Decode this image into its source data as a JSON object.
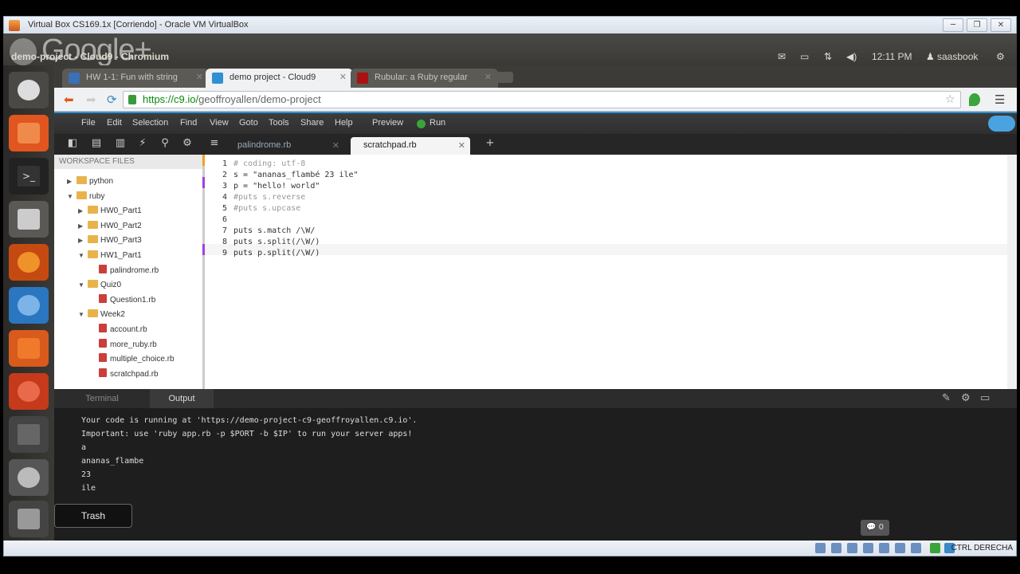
{
  "vbox": {
    "title": "Virtual Box CS169.1x [Corriendo] - Oracle VM VirtualBox",
    "status_hostkey": "CTRL DERECHA"
  },
  "ubuntu": {
    "window_title": "demo-project - Cloud9 - Chromium",
    "overlay": "Google+",
    "time": "12:11 PM",
    "user": "saasbook"
  },
  "browser": {
    "tabs": [
      {
        "label": "HW 1-1: Fun with string"
      },
      {
        "label": "demo project - Cloud9"
      },
      {
        "label": "Rubular: a Ruby regular"
      }
    ],
    "url_prefix": "https://c9.io/",
    "url_path": "geoffroyallen/demo-project"
  },
  "c9": {
    "menu": [
      "File",
      "Edit",
      "Selection",
      "Find",
      "View",
      "Goto",
      "Tools",
      "Share",
      "Help"
    ],
    "preview": "Preview",
    "run": "Run",
    "file_tabs": [
      "palindrome.rb",
      "scratchpad.rb"
    ],
    "workspace_header": "WORKSPACE FILES",
    "tree": [
      {
        "label": "python",
        "depth": 0,
        "kind": "folder",
        "arrow": "▶"
      },
      {
        "label": "ruby",
        "depth": 0,
        "kind": "folder",
        "arrow": "▼"
      },
      {
        "label": "HW0_Part1",
        "depth": 1,
        "kind": "folder",
        "arrow": "▶"
      },
      {
        "label": "HW0_Part2",
        "depth": 1,
        "kind": "folder",
        "arrow": "▶"
      },
      {
        "label": "HW0_Part3",
        "depth": 1,
        "kind": "folder",
        "arrow": "▶"
      },
      {
        "label": "HW1_Part1",
        "depth": 1,
        "kind": "folder",
        "arrow": "▼"
      },
      {
        "label": "palindrome.rb",
        "depth": 2,
        "kind": "file",
        "arrow": ""
      },
      {
        "label": "Quiz0",
        "depth": 1,
        "kind": "folder",
        "arrow": "▼"
      },
      {
        "label": "Question1.rb",
        "depth": 2,
        "kind": "file",
        "arrow": ""
      },
      {
        "label": "Week2",
        "depth": 1,
        "kind": "folder",
        "arrow": "▼"
      },
      {
        "label": "account.rb",
        "depth": 2,
        "kind": "file",
        "arrow": ""
      },
      {
        "label": "more_ruby.rb",
        "depth": 2,
        "kind": "file",
        "arrow": ""
      },
      {
        "label": "multiple_choice.rb",
        "depth": 2,
        "kind": "file",
        "arrow": ""
      },
      {
        "label": "scratchpad.rb",
        "depth": 2,
        "kind": "file",
        "arrow": ""
      }
    ],
    "code": [
      "# coding: utf-8",
      "s = \"ananas_flambé 23 ile\"",
      "p = \"hello! world\"",
      "#puts s.reverse",
      "#puts s.upcase",
      "",
      "puts s.match /\\W/",
      "puts s.split(/\\W/)",
      "puts p.split(/\\W/)"
    ],
    "bottom_tabs": [
      "Terminal",
      "Output"
    ],
    "output_prefix": "Your code is running at '",
    "output_url": "https://demo-project-c9-geoffroyallen.c9.io",
    "output_suffix": "'.",
    "output_lines": [
      "Important: use 'ruby app.rb -p $PORT -b $IP' to run your server apps!",
      "a",
      "ananas_flambe",
      "23",
      "ile"
    ],
    "chat_count": "0"
  },
  "launcher": {
    "tooltip": "Trash"
  }
}
